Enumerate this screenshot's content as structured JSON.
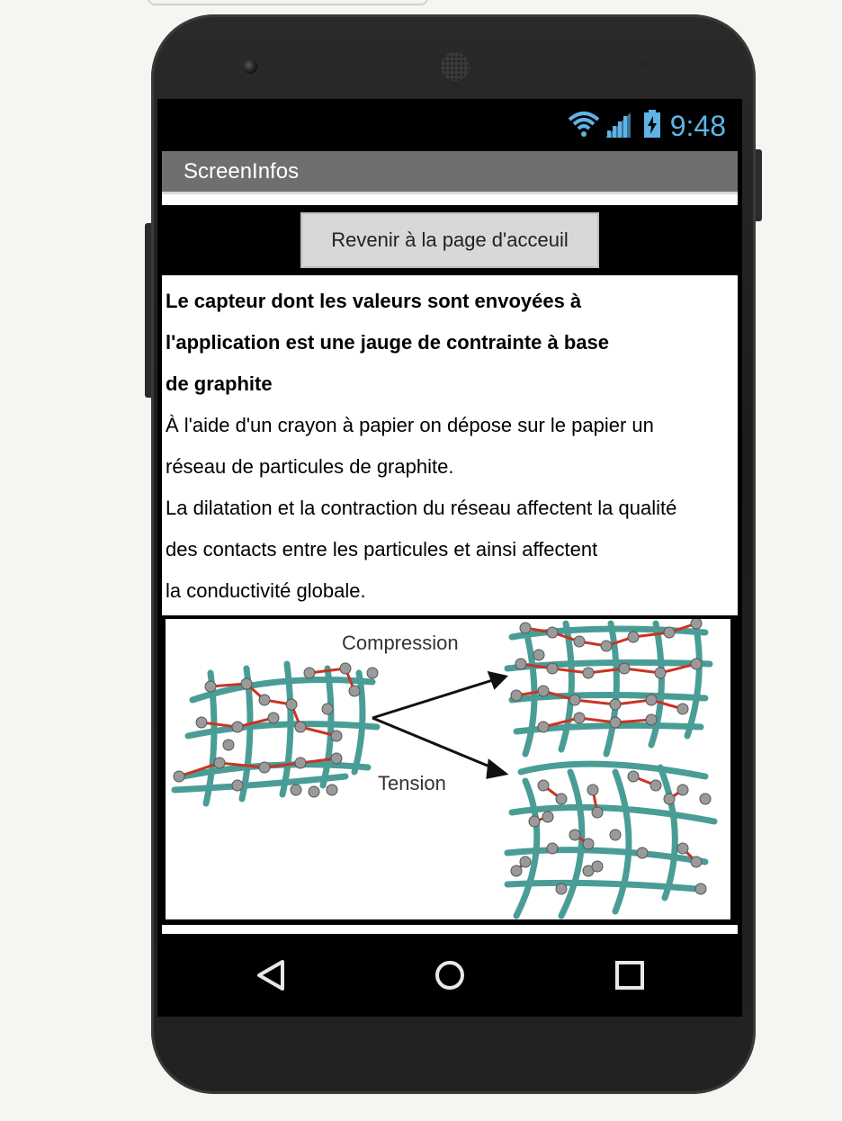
{
  "statusbar": {
    "time": "9:48",
    "wifi_icon": "wifi-icon",
    "signal_icon": "signal-icon",
    "battery_icon": "battery-charging-icon",
    "accent_color": "#5fb3e6"
  },
  "titlebar": {
    "title": "ScreenInfos",
    "background": "#6f6f6f"
  },
  "home_button": {
    "label": "Revenir à la page d'acceuil"
  },
  "description": {
    "bold_lines": [
      "Le capteur dont les valeurs sont envoyées à",
      "l'application est une jauge de contrainte à base",
      "de graphite"
    ],
    "lines": [
      "À l'aide d'un crayon à papier on dépose sur le papier un",
      "réseau de particules de graphite.",
      "La dilatation et la contraction du réseau affectent la qualité",
      "des contacts entre les particules et ainsi affectent",
      "la conductivité globale."
    ]
  },
  "figure": {
    "label_compression": "Compression",
    "label_tension": "Tension",
    "fiber_color": "#4a9d96",
    "particle_color": "#9a9a9a",
    "link_color": "#cc3322"
  },
  "navbar": {
    "back_icon": "back-triangle-icon",
    "home_icon": "home-circle-icon",
    "recents_icon": "recents-square-icon"
  }
}
